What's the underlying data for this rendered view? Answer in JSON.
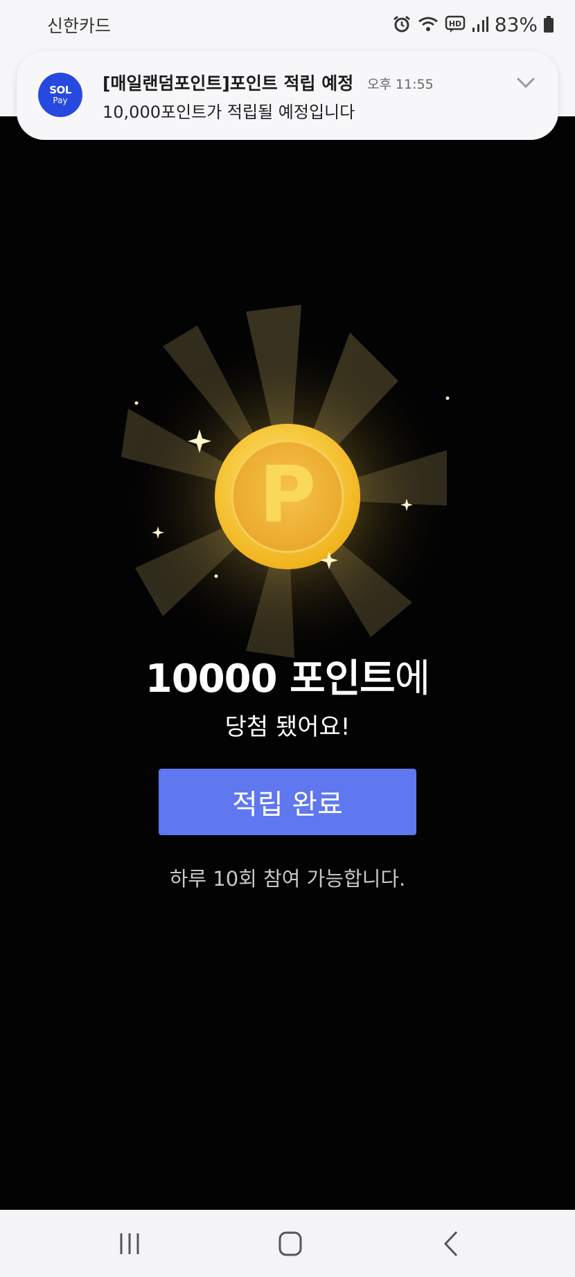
{
  "status_bar": {
    "carrier": "신한카드",
    "battery": "83%",
    "icons": [
      "alarm-icon",
      "wifi-icon",
      "hd-voice-icon",
      "signal-icon",
      "battery-icon"
    ]
  },
  "notification": {
    "app_icon_text_top": "SOL",
    "app_icon_text_bottom": "Pay",
    "title": "[매일랜덤포인트]포인트 적립 예정",
    "time": "오후 11:55",
    "body": "10,000포인트가 적립될 예정입니다"
  },
  "result": {
    "amount_bold": "10000 포인트",
    "amount_suffix": "에",
    "subtitle": "당첨 됐어요!",
    "button_label": "적립 완료",
    "note": "하루 10회 참여 가능합니다."
  },
  "coin": {
    "symbol": "P"
  },
  "colors": {
    "background": "#030303",
    "button": "#5f77ef",
    "coin": "#f5c542",
    "app_icon": "#2649e0"
  },
  "nav_bar": {
    "icons": [
      "recent-apps-icon",
      "home-icon",
      "back-icon"
    ]
  }
}
